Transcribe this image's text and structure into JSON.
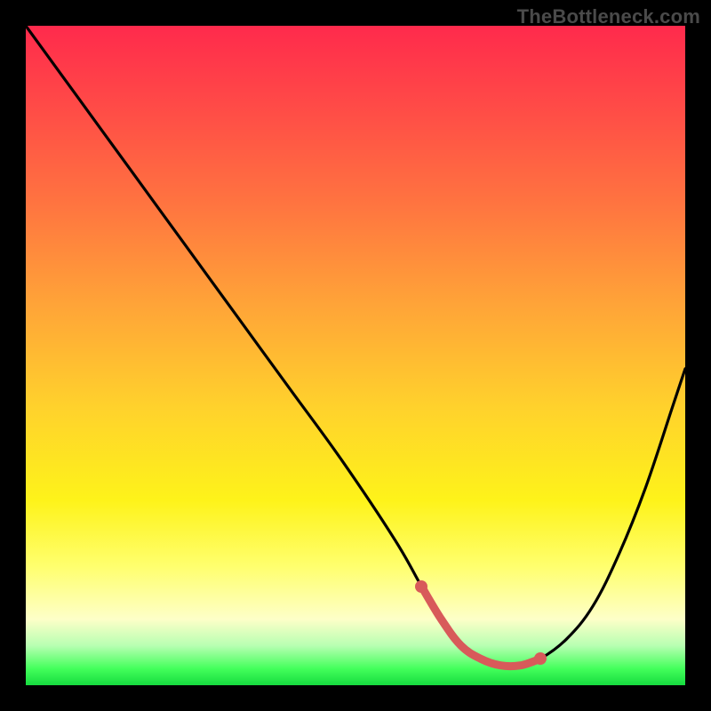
{
  "watermark": "TheBottleneck.com",
  "chart_data": {
    "type": "line",
    "title": "",
    "xlabel": "",
    "ylabel": "",
    "xlim": [
      0,
      100
    ],
    "ylim": [
      0,
      100
    ],
    "grid": false,
    "legend": false,
    "series": [
      {
        "name": "bottleneck-curve",
        "x": [
          0,
          8,
          16,
          24,
          32,
          40,
          48,
          56,
          60,
          63,
          66,
          69,
          72,
          75,
          78,
          82,
          86,
          90,
          94,
          98,
          100
        ],
        "values": [
          100,
          89,
          78,
          67,
          56,
          45,
          34,
          22,
          15,
          10,
          6,
          4,
          3,
          3,
          4,
          7,
          12,
          20,
          30,
          42,
          48
        ]
      },
      {
        "name": "highlight-band",
        "x": [
          60,
          63,
          66,
          69,
          72,
          75,
          78
        ],
        "values": [
          15,
          10,
          6,
          4,
          3,
          3,
          4
        ]
      }
    ],
    "annotations": {
      "background_gradient": [
        "#ff2a4c",
        "#ffd22c",
        "#fef31a",
        "#16db3f"
      ],
      "highlight_color": "#d85a5a",
      "curve_color": "#000000"
    }
  }
}
